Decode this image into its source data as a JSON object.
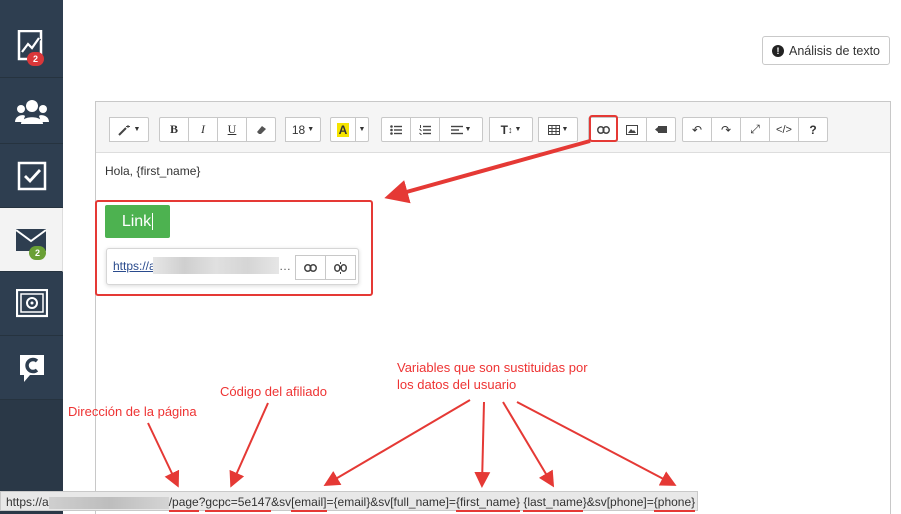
{
  "sidebar": {
    "items": [
      {
        "icon": "chart-icon",
        "badge": "2",
        "badge_color": "#d9373a"
      },
      {
        "icon": "users-icon"
      },
      {
        "icon": "checkbox-icon"
      },
      {
        "icon": "mail-icon",
        "badge": "2",
        "badge_color": "#6aa035"
      },
      {
        "icon": "safe-icon"
      },
      {
        "icon": "c-logo-icon"
      }
    ]
  },
  "header": {
    "analysis_button": "Análisis de texto"
  },
  "toolbar": {
    "font_size": "18",
    "bold": "B",
    "italic": "I",
    "underline": "U",
    "text_size_label": "T",
    "undo": "↶",
    "redo": "↷",
    "fullscreen": "⤢",
    "code": "</>",
    "help": "?"
  },
  "editor": {
    "greeting": "Hola, {first_name}",
    "link_button": "Link",
    "link_url_prefix": "https://a",
    "link_url_suffix": "…"
  },
  "annotations": {
    "page_address": "Dirección de la página",
    "affiliate_code": "Código del afiliado",
    "variables_line1": "Variables que son sustituidas por",
    "variables_line2": "los datos del usuario"
  },
  "statusbar": {
    "prefix": "https://a",
    "path": "/page",
    "q": "?",
    "gcpc": "gcpc=5e147",
    "amp_sv": "&sv",
    "email_key": "[email]",
    "eq_email": "={email}&sv[full_name]=",
    "first_name": "{first_name}",
    "space": " ",
    "last_name": "{last_name",
    "phone_part": "}&sv[phone]=",
    "phone": "{phone}"
  },
  "colors": {
    "accent_red": "#e53935",
    "link_green": "#4db250",
    "sidebar": "#2e3e50"
  }
}
